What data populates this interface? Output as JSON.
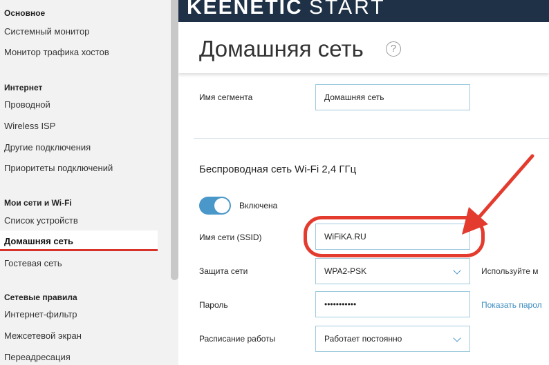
{
  "sidebar": {
    "groups": [
      {
        "title": "Основное",
        "items": [
          "Системный монитор",
          "Монитор трафика хостов"
        ]
      },
      {
        "title": "Интернет",
        "items": [
          "Проводной",
          "Wireless ISP",
          "Другие подключения",
          "Приоритеты подключений"
        ]
      },
      {
        "title": "Мои сети и Wi-Fi",
        "items": [
          "Список устройств",
          "Домашняя сеть",
          "Гостевая сеть"
        ]
      },
      {
        "title": "Сетевые правила",
        "items": [
          "Интернет-фильтр",
          "Межсетевой экран",
          "Переадресация"
        ]
      }
    ],
    "active_item": "Домашняя сеть"
  },
  "header": {
    "brand_bold": "KEENETIC",
    "brand_light": "START"
  },
  "page": {
    "title": "Домашняя сеть",
    "help_glyph": "?"
  },
  "form": {
    "segment_label": "Имя сегмента",
    "segment_value": "Домашняя сеть",
    "wifi_section_title": "Беспроводная сеть Wi-Fi 2,4 ГГц",
    "enabled_label": "Включена",
    "ssid_label": "Имя сети (SSID)",
    "ssid_value": "WiFiKA.RU",
    "security_label": "Защита сети",
    "security_value": "WPA2-PSK",
    "security_hint": "Используйте м",
    "password_label": "Пароль",
    "password_value": "•••••••••••",
    "show_password_link": "Показать парол",
    "schedule_label": "Расписание работы",
    "schedule_value": "Работает постоянно"
  },
  "colors": {
    "topbar": "#1f3146",
    "accent": "#4a97c9",
    "annotation": "#e43b2f"
  }
}
